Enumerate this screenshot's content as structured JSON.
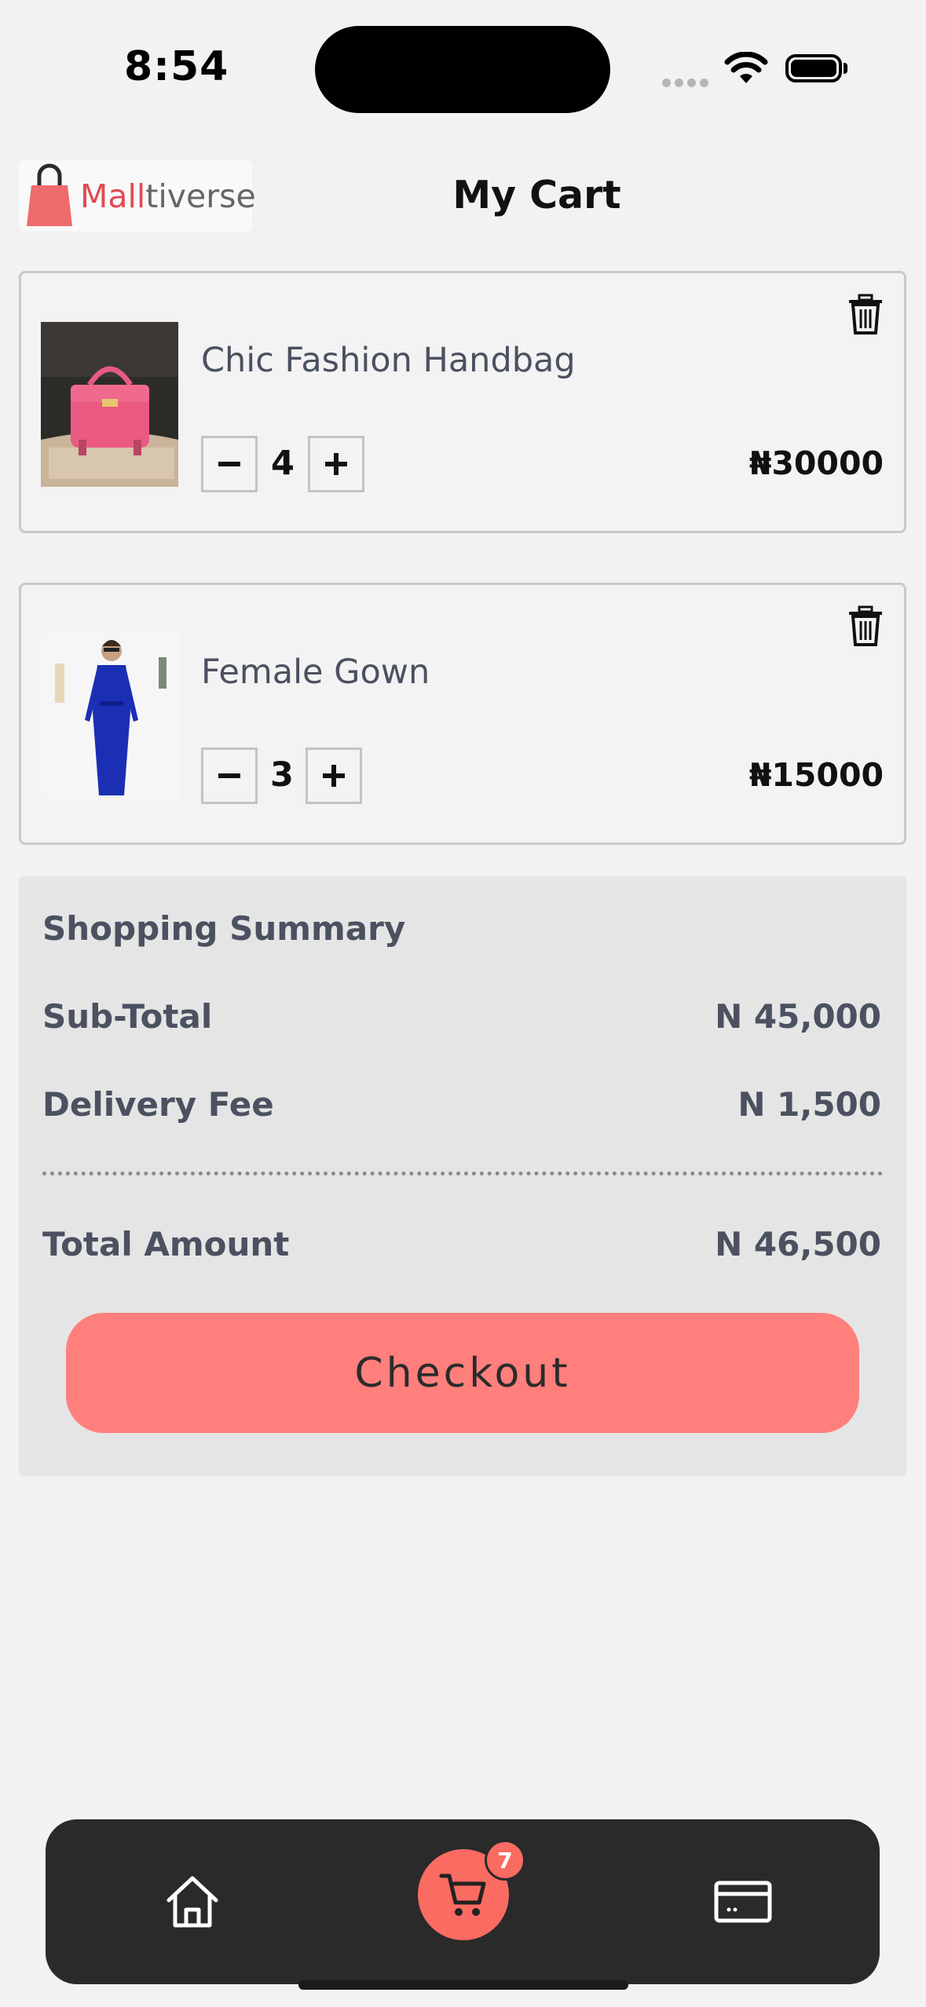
{
  "status_bar": {
    "time": "8:54"
  },
  "header": {
    "logo_text_primary": "Mall",
    "logo_text_secondary": "tiverse",
    "title": "My Cart"
  },
  "cart_items": [
    {
      "name": "Chic Fashion Handbag",
      "quantity": "4",
      "price": "₦30000",
      "image": "pink-handbag"
    },
    {
      "name": "Female Gown",
      "quantity": "3",
      "price": "₦15000",
      "image": "blue-gown"
    }
  ],
  "summary": {
    "title": "Shopping Summary",
    "subtotal_label": "Sub-Total",
    "subtotal_value": "N 45,000",
    "delivery_label": "Delivery Fee",
    "delivery_value": "N 1,500",
    "total_label": "Total Amount",
    "total_value": "N 46,500",
    "checkout_label": "Checkout"
  },
  "nav": {
    "cart_badge": "7",
    "items": [
      "home-icon",
      "cart-icon",
      "card-icon"
    ]
  },
  "colors": {
    "accent": "#ff7f7c",
    "nav_bg": "#2a2a2a",
    "cart_active": "#fa6b62",
    "text_muted": "#4b5160"
  }
}
